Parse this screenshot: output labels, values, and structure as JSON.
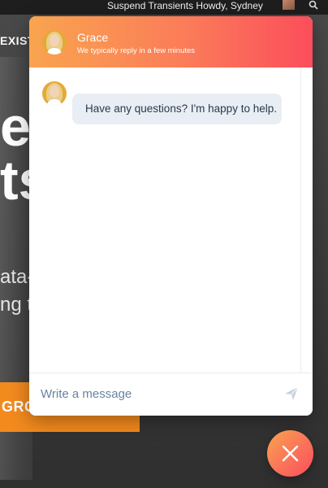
{
  "background_page": {
    "admin_bar_text": "Suspend Transients    Howdy, Sydney",
    "exist_label": "EXIST",
    "headline_line1": "er",
    "headline_line2": "ts",
    "body_line1": "ata-",
    "body_line2": "ng to",
    "cta_label": "GRO"
  },
  "chat": {
    "agent_name": "Grace",
    "agent_status": "We typically reply in a few minutes",
    "messages": [
      {
        "sender": "agent",
        "text": "Have any questions? I'm happy to help."
      }
    ],
    "input": {
      "placeholder": "Write a message",
      "value": ""
    },
    "send_icon": "paper-plane-icon",
    "launcher_icon": "close-icon"
  },
  "colors": {
    "header_gradient_start": "#f9a44f",
    "header_gradient_end": "#fb4e5b",
    "bubble_background": "#e9eef4",
    "bubble_text": "#28394c",
    "placeholder_text": "#6a82a0"
  }
}
